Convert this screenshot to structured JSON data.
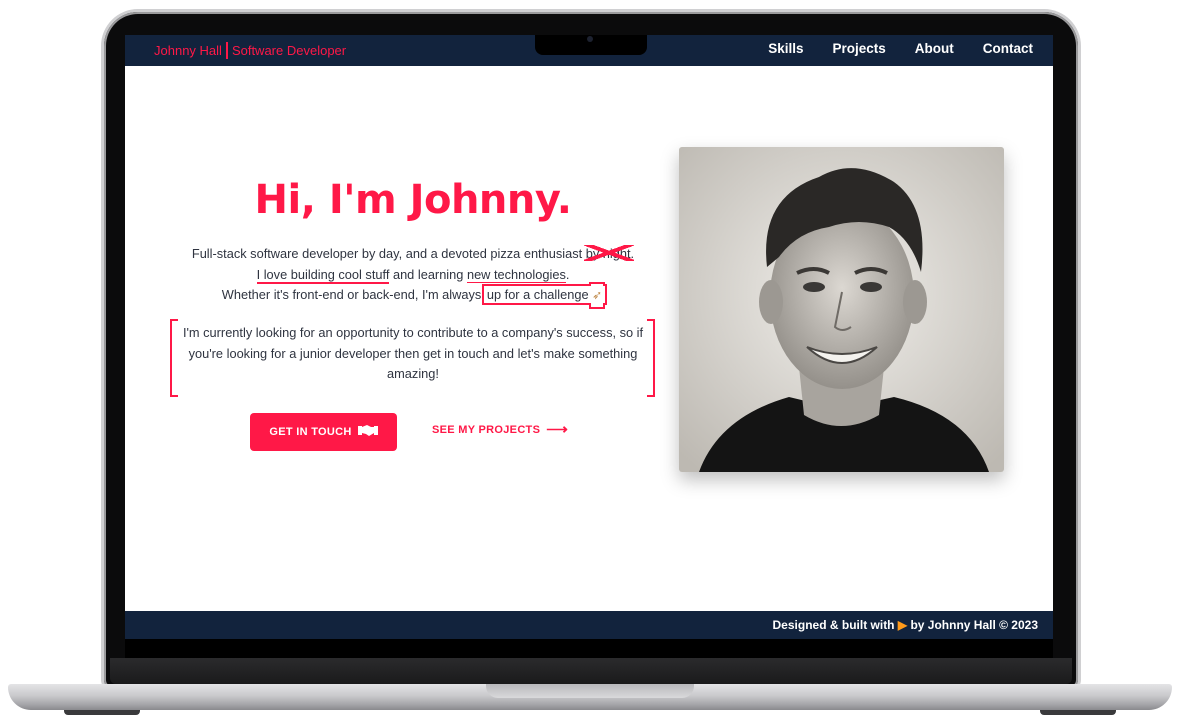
{
  "nav": {
    "brand_name": "Johnny Hall",
    "brand_role": "Software Developer",
    "links": [
      "Skills",
      "Projects",
      "About",
      "Contact"
    ]
  },
  "hero": {
    "title": "Hi, I'm Johnny.",
    "line1_a": "Full-stack software developer by day, and a devoted pizza enthusiast ",
    "line1_strike": "by night",
    "line1_end": ".",
    "line2_highlight": "I love building cool stuff",
    "line2_mid": " and learning ",
    "line2_under": "new technologies",
    "line2_end": ".",
    "line3_a": "Whether it's front-end or back-end, I'm always ",
    "line3_box": "up for a challenge",
    "rocket_icon": "rocket-icon",
    "bracket_text": "I'm currently looking for an opportunity to contribute to a company's success, so if you're looking for a junior developer then get in touch and let's make something amazing!",
    "cta_primary": "GET IN TOUCH",
    "cta_secondary": "SEE MY PROJECTS"
  },
  "footer": {
    "text_a": "Designed & built with",
    "text_b": "by Johnny Hall © 2023"
  },
  "colors": {
    "accent": "#ff1847",
    "navy": "#12233d"
  }
}
